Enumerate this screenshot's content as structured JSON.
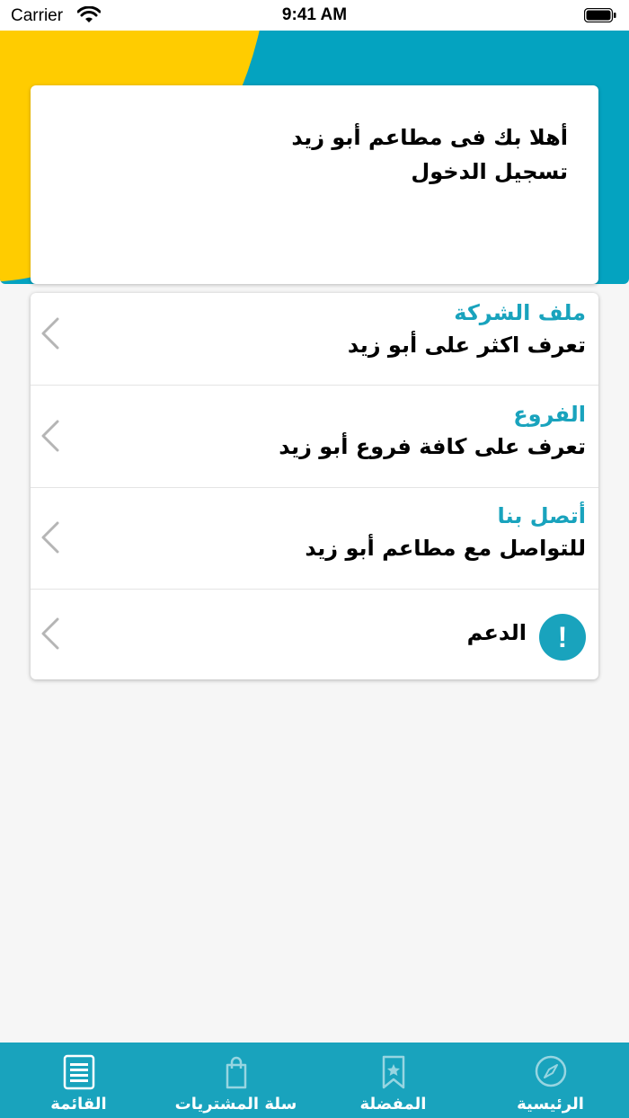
{
  "status_bar": {
    "carrier": "Carrier",
    "time": "9:41 AM"
  },
  "welcome": {
    "line1": "أهلا بك فى مطاعم أبو زيد",
    "line2": "تسجيل الدخول"
  },
  "menu": {
    "items": [
      {
        "title": "ملف الشركة",
        "subtitle": "تعرف اكثر على أبو زيد"
      },
      {
        "title": "الفروع",
        "subtitle": "تعرف على كافة فروع أبو زيد"
      },
      {
        "title": "أتصل بنا",
        "subtitle": "للتواصل مع مطاعم أبو زيد"
      },
      {
        "title": "الدعم"
      }
    ]
  },
  "tabs": [
    {
      "label": "الرئيسية",
      "icon": "compass-icon"
    },
    {
      "label": "المفضلة",
      "icon": "bookmark-icon"
    },
    {
      "label": "سلة المشتريات",
      "icon": "shopping-bag-icon"
    },
    {
      "label": "القائمة",
      "icon": "list-icon",
      "active": true
    }
  ],
  "colors": {
    "accent": "#19a3bd",
    "header": "#04a3c0",
    "yellow": "#ffcc00"
  }
}
